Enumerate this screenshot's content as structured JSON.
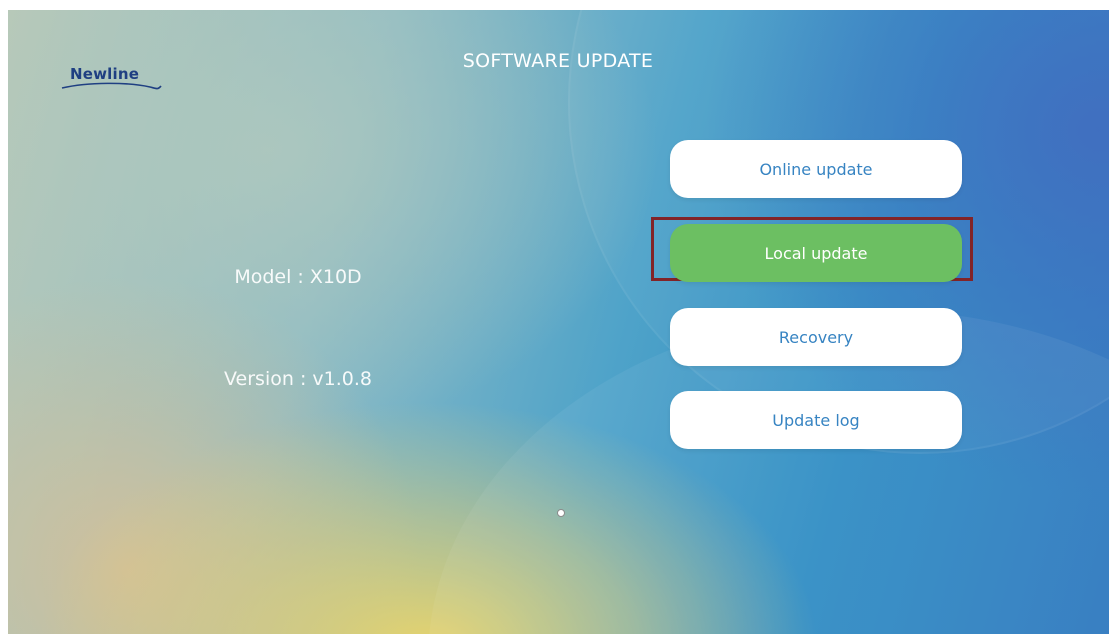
{
  "brand": {
    "logo_text": "Newline",
    "logo_color": "#1f3f82"
  },
  "header": {
    "title": "SOFTWARE UPDATE"
  },
  "device": {
    "model": "Model : X10D",
    "version": "Version : v1.0.8"
  },
  "menu": {
    "items": [
      {
        "label": "Online update",
        "selected": false
      },
      {
        "label": "Local update",
        "selected": true
      },
      {
        "label": "Recovery",
        "selected": false
      },
      {
        "label": "Update log",
        "selected": false
      }
    ],
    "selected_color": "#67bd5c",
    "text_color": "#2f7fc0",
    "focus_color": "#7d1c20"
  },
  "pointer": {
    "icon": "cursor-dot-icon"
  }
}
